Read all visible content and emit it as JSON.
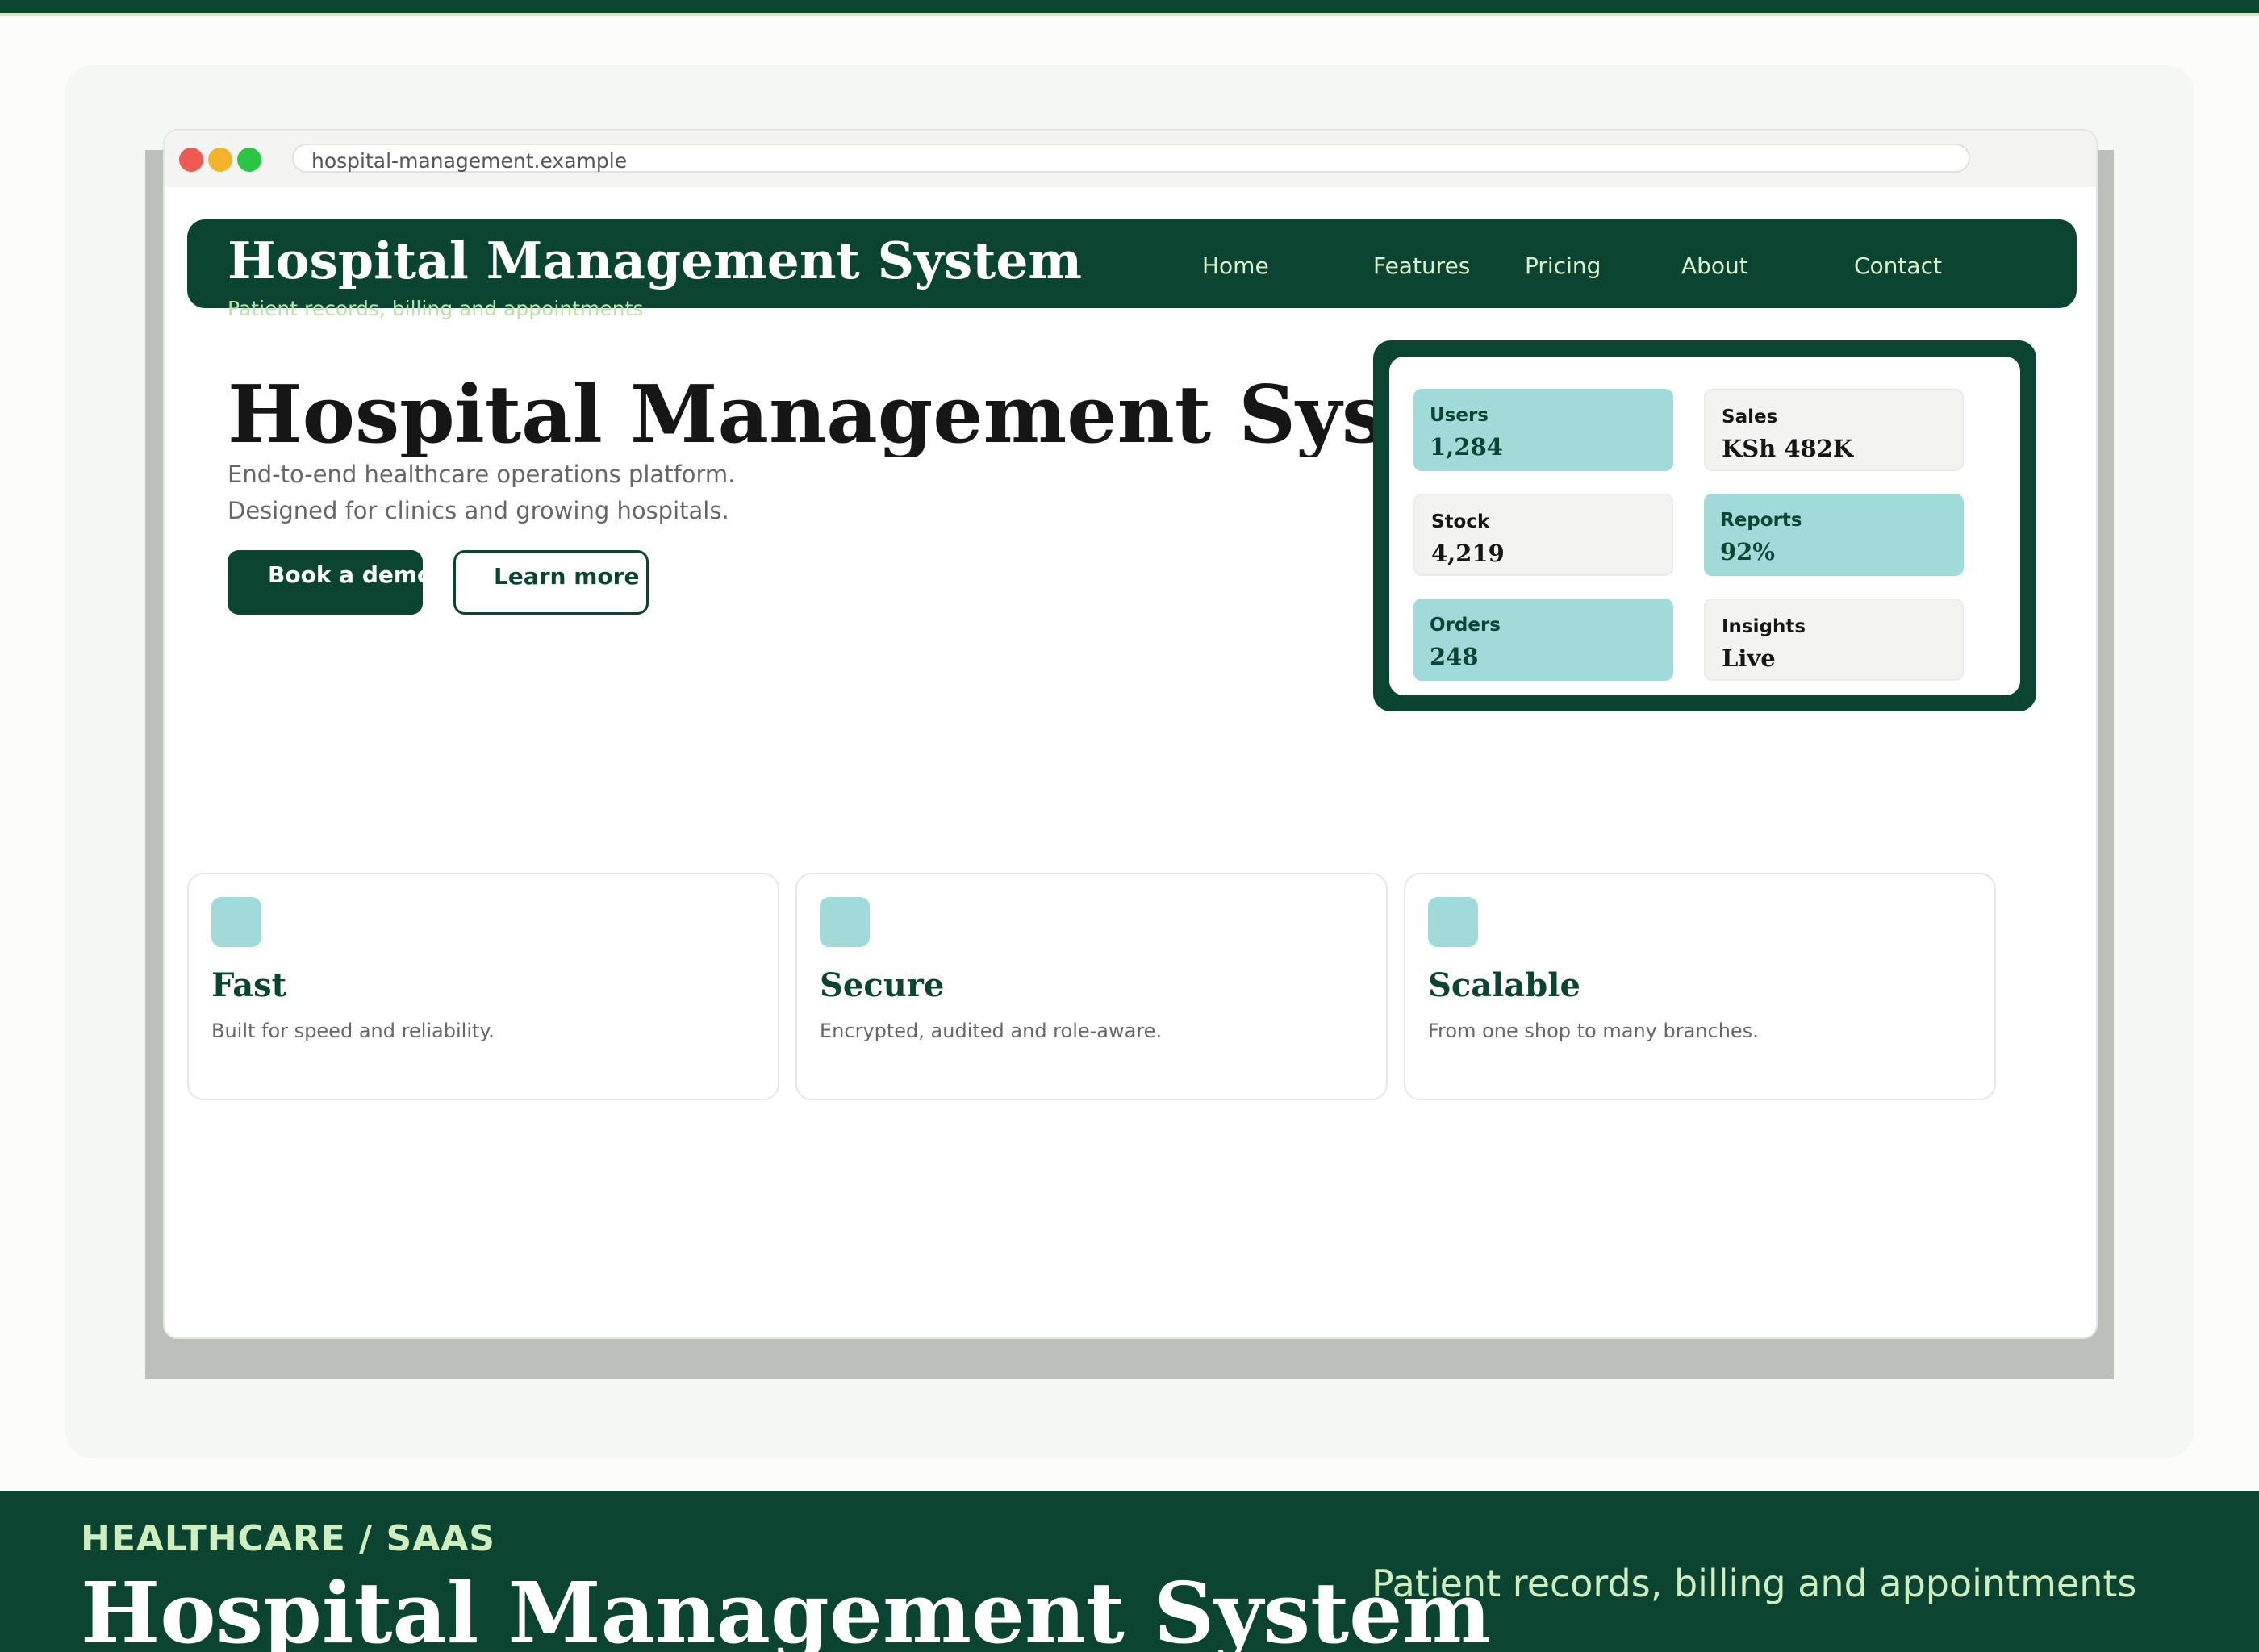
{
  "browser": {
    "url": "hospital-management.example"
  },
  "header": {
    "title": "Hospital Management System",
    "subtitle": "Patient records, billing and appointments",
    "nav": [
      "Home",
      "Features",
      "Pricing",
      "About",
      "Contact"
    ]
  },
  "hero": {
    "title": "Hospital Management System",
    "lines": [
      "End-to-end healthcare operations platform.",
      "Designed for clinics and growing hospitals."
    ],
    "primary_button": "Book a demo",
    "secondary_button": "Learn more"
  },
  "stats": [
    {
      "label": "Users",
      "value": "1,284"
    },
    {
      "label": "Sales",
      "value": "KSh 482K"
    },
    {
      "label": "Stock",
      "value": "4,219"
    },
    {
      "label": "Reports",
      "value": "92%"
    },
    {
      "label": "Orders",
      "value": "248"
    },
    {
      "label": "Insights",
      "value": "Live"
    }
  ],
  "features": [
    {
      "title": "Fast",
      "description": "Built for speed and reliability."
    },
    {
      "title": "Secure",
      "description": "Encrypted, audited and role-aware."
    },
    {
      "title": "Scalable",
      "description": "From one shop to many branches."
    }
  ],
  "footer": {
    "eyebrow": "HEALTHCARE / SAAS",
    "title": "Hospital Management System",
    "subtitle": "Patient records, billing and appointments"
  },
  "colors": {
    "brand": "#0b4532",
    "accent_teal": "#a0dbda",
    "accent_light": "#cfeebf"
  }
}
